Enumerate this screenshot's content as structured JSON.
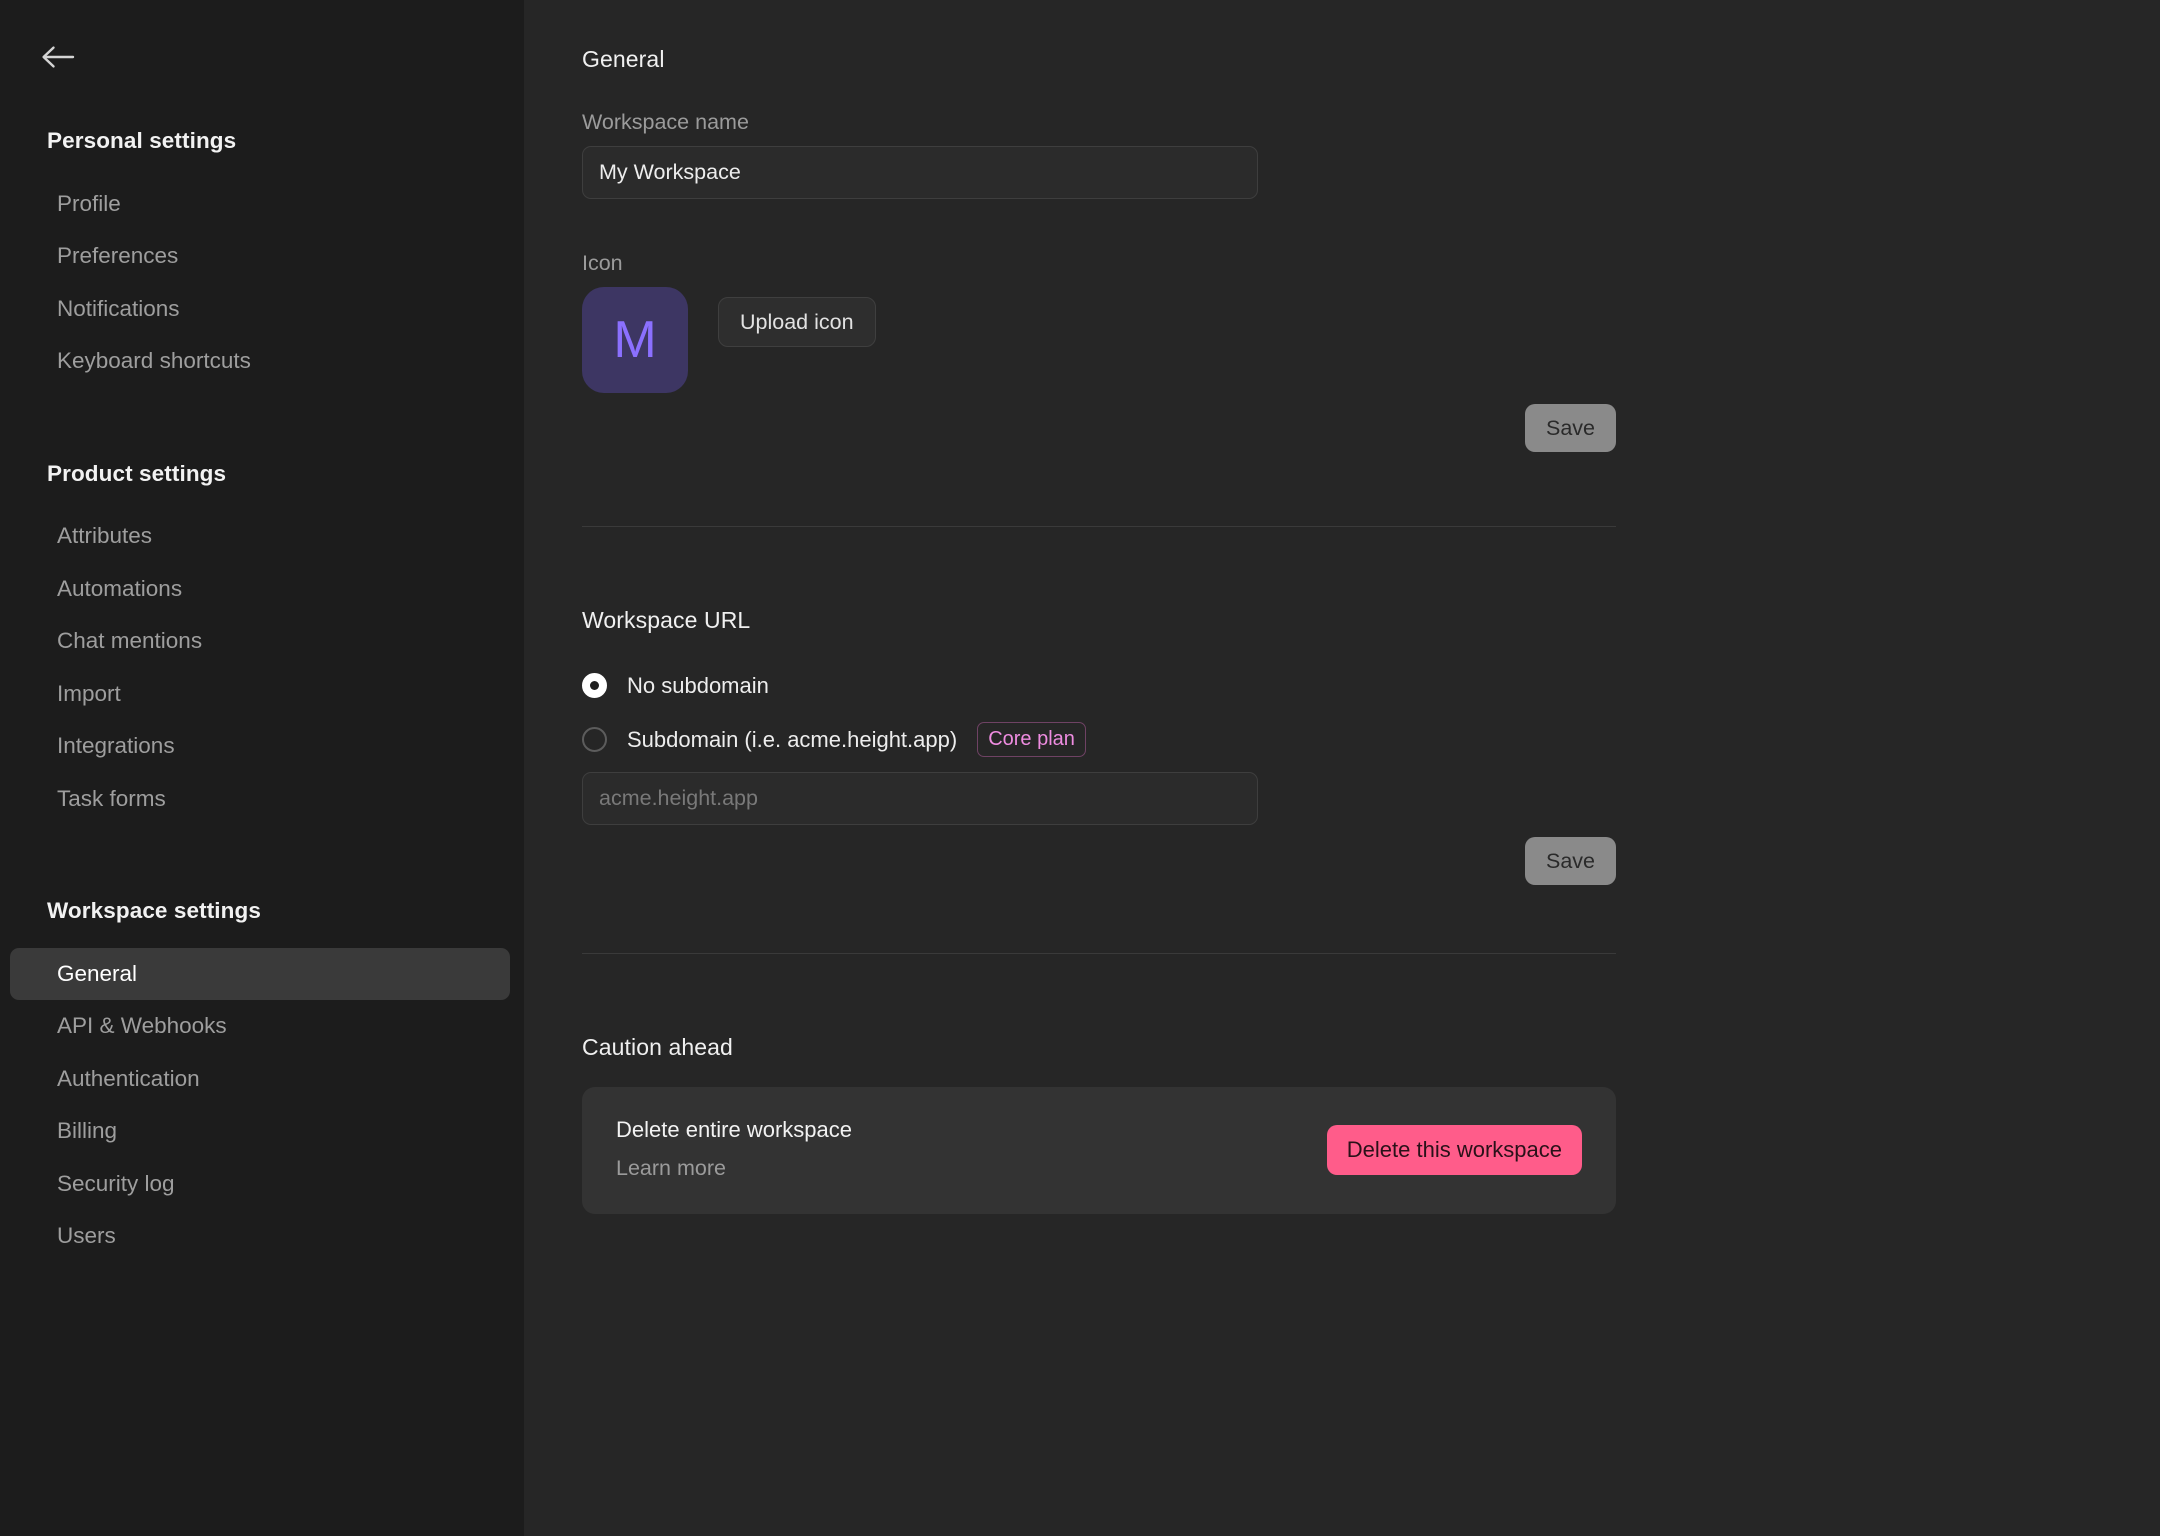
{
  "sidebar": {
    "back_icon": "arrow-left-icon",
    "groups": [
      {
        "title": "Personal settings",
        "items": [
          {
            "label": "Profile",
            "active": false
          },
          {
            "label": "Preferences",
            "active": false
          },
          {
            "label": "Notifications",
            "active": false
          },
          {
            "label": "Keyboard shortcuts",
            "active": false
          }
        ]
      },
      {
        "title": "Product settings",
        "items": [
          {
            "label": "Attributes",
            "active": false
          },
          {
            "label": "Automations",
            "active": false
          },
          {
            "label": "Chat mentions",
            "active": false
          },
          {
            "label": "Import",
            "active": false
          },
          {
            "label": "Integrations",
            "active": false
          },
          {
            "label": "Task forms",
            "active": false
          }
        ]
      },
      {
        "title": "Workspace settings",
        "items": [
          {
            "label": "General",
            "active": true
          },
          {
            "label": "API & Webhooks",
            "active": false
          },
          {
            "label": "Authentication",
            "active": false
          },
          {
            "label": "Billing",
            "active": false
          },
          {
            "label": "Security log",
            "active": false
          },
          {
            "label": "Users",
            "active": false
          }
        ]
      }
    ]
  },
  "general": {
    "heading": "General",
    "workspace_name_label": "Workspace name",
    "workspace_name_value": "My Workspace",
    "workspace_name_placeholder": "Workspace name",
    "icon_label": "Icon",
    "icon_initial": "M",
    "upload_icon_label": "Upload icon",
    "save_label": "Save"
  },
  "workspace_url": {
    "heading": "Workspace URL",
    "option_no_subdomain": "No subdomain",
    "option_subdomain": "Subdomain (i.e. acme.height.app)",
    "plan_badge": "Core plan",
    "subdomain_value": "",
    "subdomain_placeholder": "acme.height.app",
    "save_label": "Save"
  },
  "caution": {
    "heading": "Caution ahead",
    "card_title": "Delete entire workspace",
    "card_link": "Learn more",
    "delete_label": "Delete this workspace"
  },
  "colors": {
    "sidebar_bg": "#1C1C1C",
    "main_bg": "#262626",
    "accent_purple": "#8B70FF",
    "icon_tile_bg": "#3D3663",
    "danger_pink": "#FF5C8A",
    "plan_badge_text": "#EE8CE0",
    "active_item_bg": "#3A3A3A"
  }
}
